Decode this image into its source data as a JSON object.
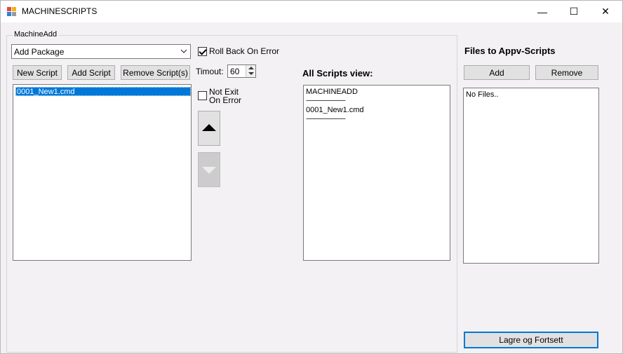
{
  "window": {
    "title": "MACHINESCRIPTS",
    "controls": {
      "minimize": "—",
      "maximize": "☐",
      "close": "✕"
    }
  },
  "group": {
    "label": "MachineAdd"
  },
  "package_combo": {
    "value": "Add Package"
  },
  "rollback": {
    "label": "Roll Back On Error",
    "checked": true
  },
  "buttons": {
    "new_script": "New Script",
    "add_script": "Add Script",
    "remove_script": "Remove Script(s)"
  },
  "timeout": {
    "label": "Timout:",
    "value": "60"
  },
  "not_exit": {
    "line1": "Not Exit",
    "line2": "On Error",
    "checked": false
  },
  "scripts_list": {
    "items": [
      "0001_New1.cmd"
    ]
  },
  "all_scripts": {
    "heading": "All Scripts view:",
    "lines": [
      "MACHINEADD",
      "----------------------------",
      "0001_New1.cmd",
      "----------------------------"
    ]
  },
  "appv": {
    "heading": "Files to Appv-Scripts",
    "add": "Add",
    "remove": "Remove",
    "empty_text": "No Files.."
  },
  "save_button": "Lagre og Fortsett",
  "icons": {
    "app": "app-window-icon",
    "dropdown": "chevron-down-icon",
    "move_up": "triangle-up-icon",
    "move_down": "triangle-down-icon"
  }
}
